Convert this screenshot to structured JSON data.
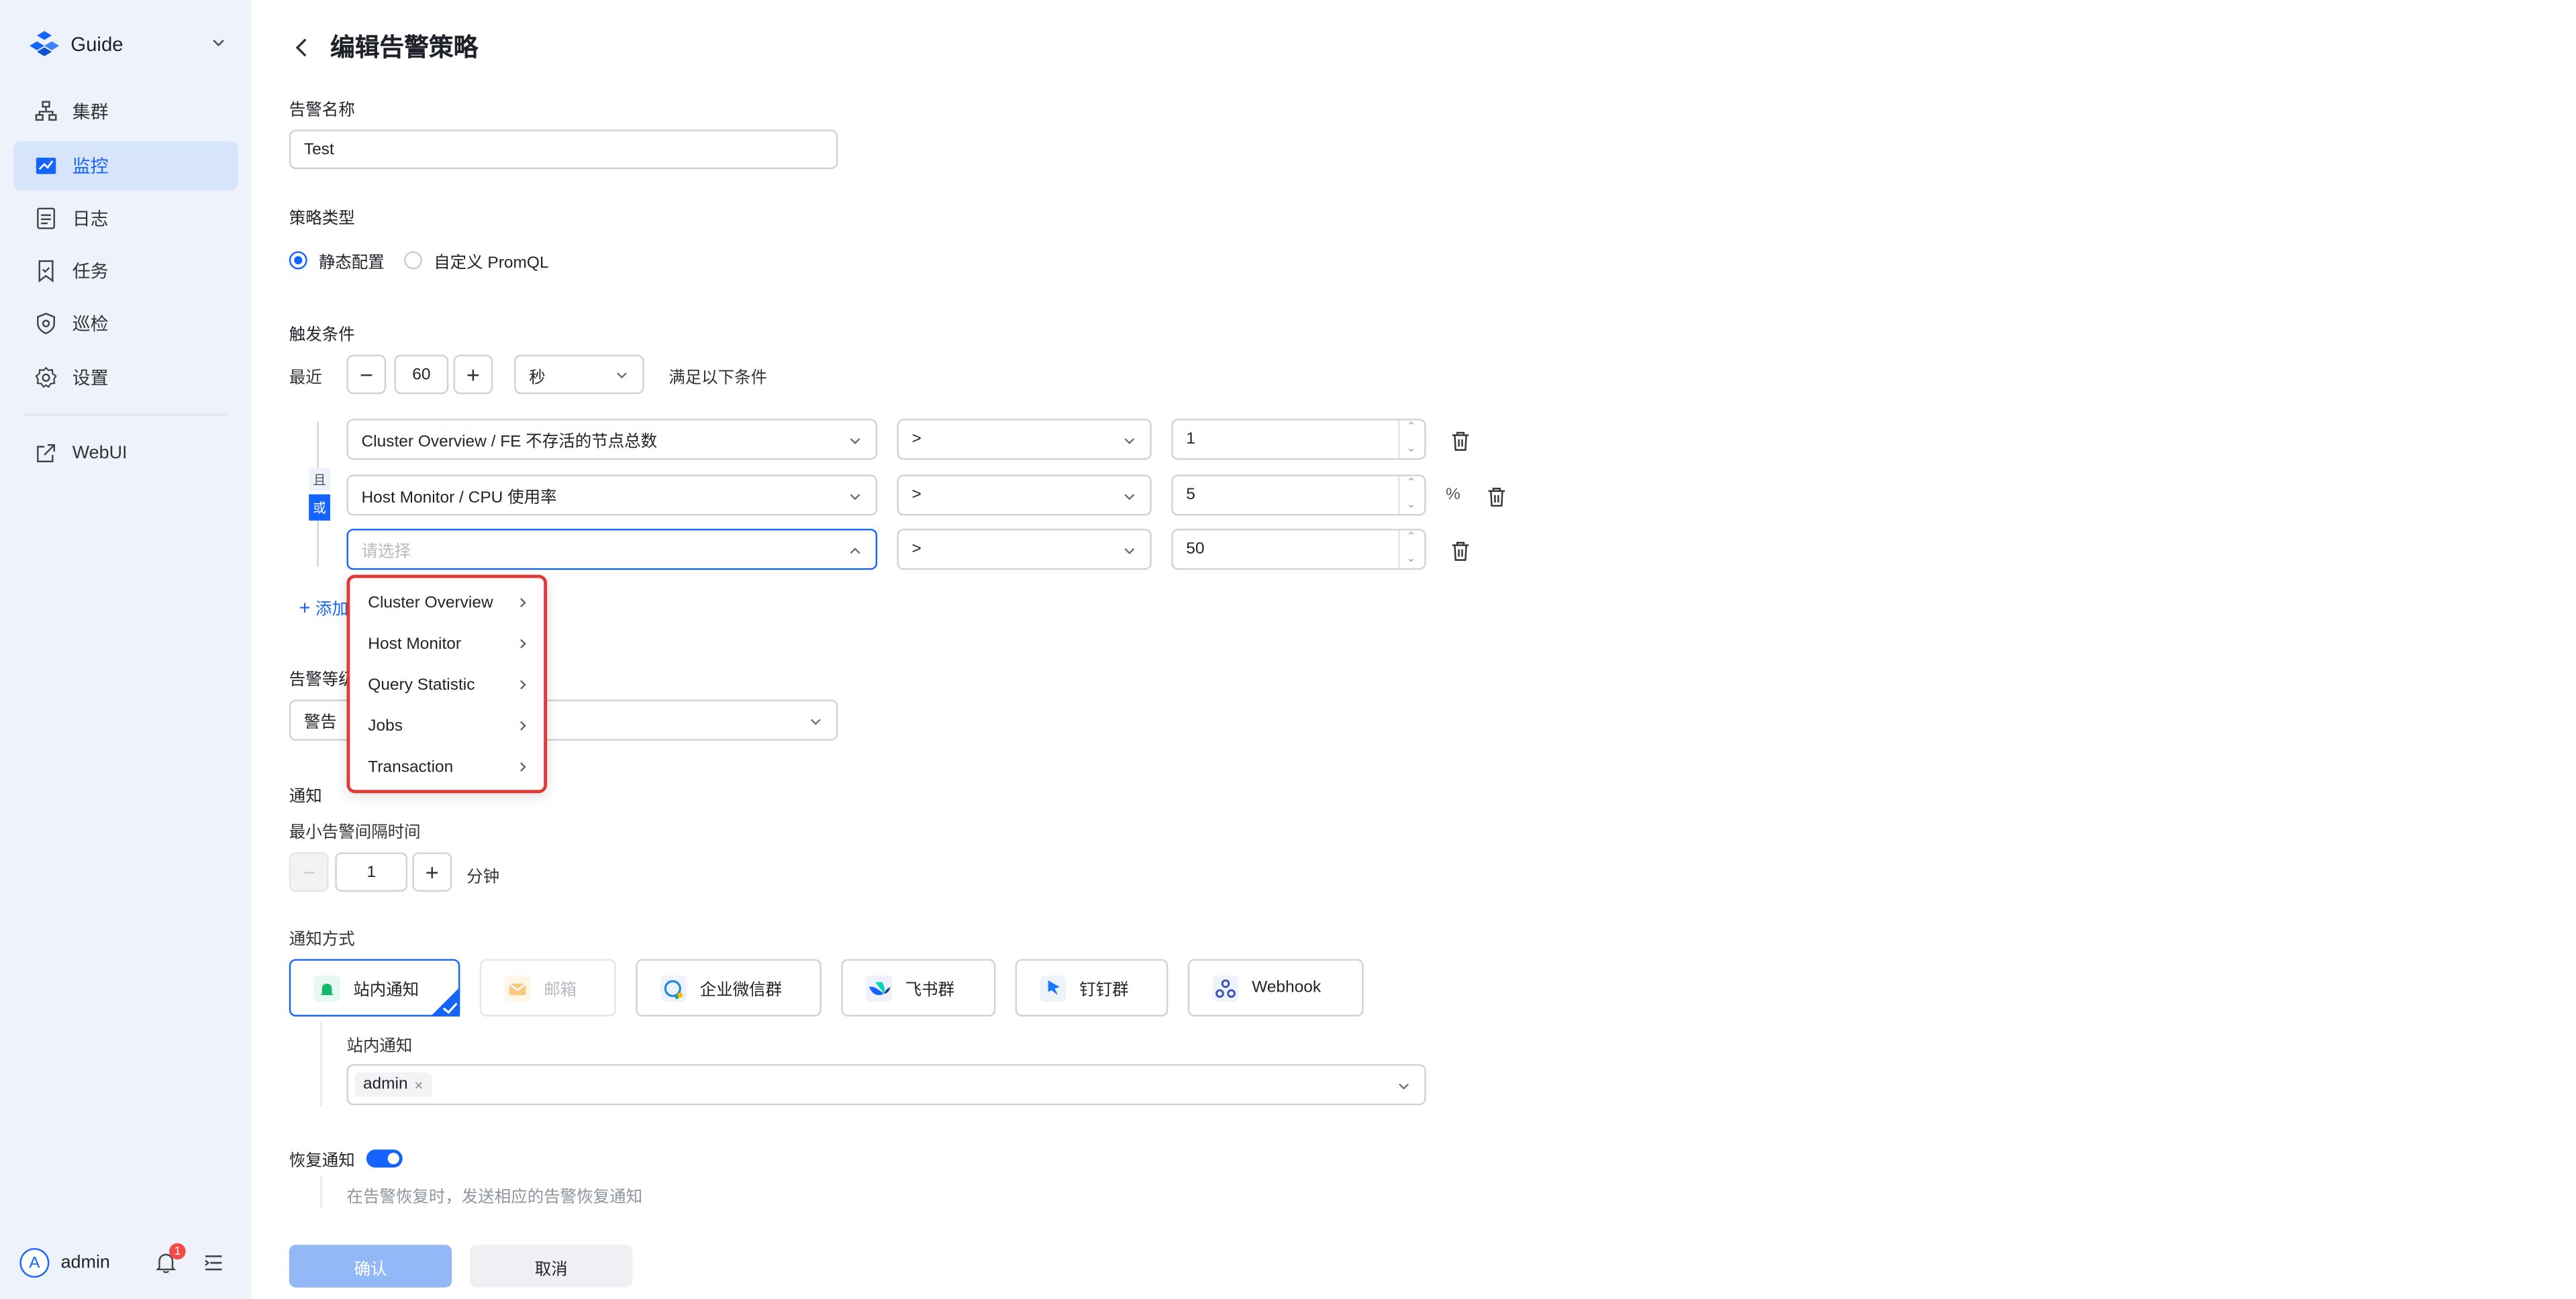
{
  "sidebar": {
    "brand": "Guide",
    "items": [
      {
        "label": "集群",
        "icon": "cluster-icon"
      },
      {
        "label": "监控",
        "icon": "monitor-chart-icon"
      },
      {
        "label": "日志",
        "icon": "log-document-icon"
      },
      {
        "label": "任务",
        "icon": "task-bookmark-icon"
      },
      {
        "label": "巡检",
        "icon": "inspection-shield-icon"
      },
      {
        "label": "设置",
        "icon": "gear-icon"
      },
      {
        "label": "WebUI",
        "icon": "external-link-icon"
      }
    ],
    "user": {
      "avatar": "A",
      "name": "admin",
      "notifications": "1"
    }
  },
  "page": {
    "title": "编辑告警策略"
  },
  "form": {
    "name": {
      "label": "告警名称",
      "value": "Test"
    },
    "strategy": {
      "label": "策略类型",
      "options": [
        "静态配置",
        "自定义 PromQL"
      ],
      "selected": "静态配置"
    },
    "trigger": {
      "label": "触发条件",
      "recent_label": "最近",
      "duration": "60",
      "unit": "秒",
      "suffix": "满足以下条件",
      "logic_and": "且",
      "logic_or": "或",
      "conditions": [
        {
          "metric": "Cluster Overview / FE 不存活的节点总数",
          "op": ">",
          "value": "1",
          "unit": ""
        },
        {
          "metric": "Host Monitor / CPU 使用率",
          "op": ">",
          "value": "5",
          "unit": "%"
        },
        {
          "metric": "",
          "placeholder": "请选择",
          "op": ">",
          "value": "50",
          "unit": ""
        }
      ],
      "add_label": "添加",
      "dropdown": [
        "Cluster Overview",
        "Host Monitor",
        "Query Statistic",
        "Jobs",
        "Transaction"
      ]
    },
    "level": {
      "label": "告警等级",
      "value": "警告"
    },
    "notify": {
      "label": "通知",
      "interval_label": "最小告警间隔时间",
      "interval_value": "1",
      "interval_unit": "分钟",
      "method_label": "通知方式",
      "methods": [
        "站内通知",
        "邮箱",
        "企业微信群",
        "飞书群",
        "钉钉群",
        "Webhook"
      ],
      "inbox_label": "站内通知",
      "recipient": "admin"
    },
    "recovery": {
      "label": "恢复通知",
      "enabled": true,
      "hint": "在告警恢复时，发送相应的告警恢复通知"
    },
    "confirm": "确认",
    "cancel": "取消"
  },
  "colors": {
    "accent": "#1664ff",
    "highlight": "#e03b35",
    "sidebar_bg": "#eef3fb"
  }
}
